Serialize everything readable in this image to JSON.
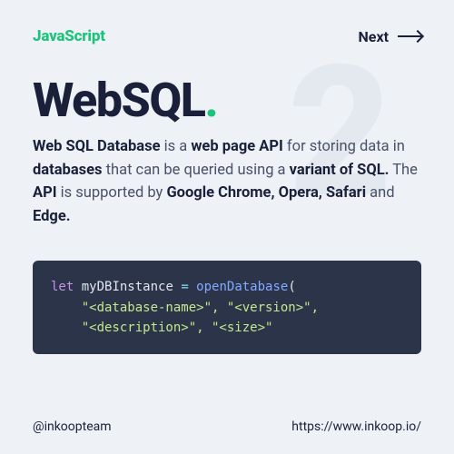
{
  "header": {
    "brand": "JavaScript",
    "next_label": "Next"
  },
  "ghost_number": "2",
  "title": {
    "text": "WebSQL",
    "dot": "."
  },
  "description": {
    "parts": [
      {
        "t": "Web SQL Database",
        "b": true
      },
      {
        "t": " is a ",
        "b": false
      },
      {
        "t": "web page API",
        "b": true
      },
      {
        "t": " for storing data in ",
        "b": false
      },
      {
        "t": "databases",
        "b": true
      },
      {
        "t": " that can be queried using a ",
        "b": false
      },
      {
        "t": "variant of SQL.",
        "b": true
      },
      {
        "t": " The ",
        "b": false
      },
      {
        "t": "API",
        "b": true
      },
      {
        "t": " is supported by ",
        "b": false
      },
      {
        "t": "Google Chrome, Opera, Safari",
        "b": true
      },
      {
        "t": " and ",
        "b": false
      },
      {
        "t": "Edge.",
        "b": true
      }
    ]
  },
  "code": {
    "line1": {
      "kw": "let",
      "var": " myDBInstance ",
      "op": "= ",
      "fn": "openDatabase",
      "pn": "("
    },
    "line2": "    \"<database-name>\", \"<version>\",",
    "line3": "    \"<description>\", \"<size>\""
  },
  "footer": {
    "handle": "@inkoopteam",
    "url": "https://www.inkoop.io/"
  }
}
